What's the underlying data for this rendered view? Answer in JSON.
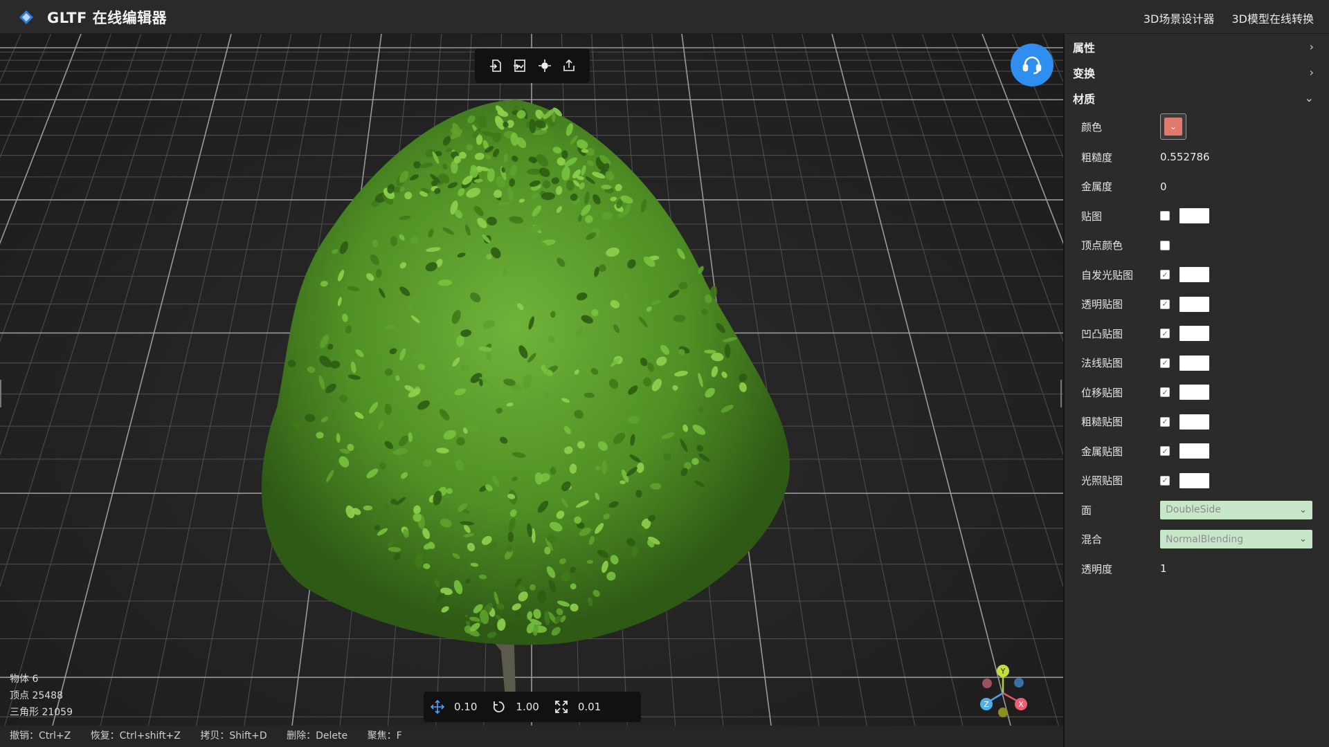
{
  "app": {
    "title": "GLTF 在线编辑器",
    "links": [
      "3D场景设计器",
      "3D模型在线转换"
    ]
  },
  "toolbar_top": {
    "icons": [
      "import-icon",
      "import-image-icon",
      "center-icon",
      "export-icon"
    ]
  },
  "stats": {
    "objects": "物体 6",
    "vertices": "顶点 25488",
    "triangles": "三角形 21059"
  },
  "transform_snap": {
    "translate": "0.10",
    "rotate": "1.00",
    "scale": "0.01"
  },
  "shortcuts": [
    "撤销：Ctrl+Z",
    "恢复：Ctrl+shift+Z",
    "拷贝：Shift+D",
    "删除：Delete",
    "聚焦：F"
  ],
  "gizmo": {
    "x": "X",
    "y": "Y",
    "z": "Z"
  },
  "panel": {
    "sections": {
      "properties": "属性",
      "transform": "变换",
      "material": "材质"
    },
    "material": {
      "color_label": "颜色",
      "color_value": "#e07a6a",
      "roughness_label": "粗糙度",
      "roughness_value": "0.552786",
      "metalness_label": "金属度",
      "metalness_value": "0",
      "maps": [
        {
          "label": "贴图",
          "checked": false,
          "swatch": true
        },
        {
          "label": "顶点颜色",
          "checked": false,
          "swatch": false
        },
        {
          "label": "自发光贴图",
          "checked": true,
          "swatch": true
        },
        {
          "label": "透明贴图",
          "checked": true,
          "swatch": true
        },
        {
          "label": "凹凸贴图",
          "checked": true,
          "swatch": true
        },
        {
          "label": "法线贴图",
          "checked": true,
          "swatch": true
        },
        {
          "label": "位移贴图",
          "checked": true,
          "swatch": true
        },
        {
          "label": "粗糙贴图",
          "checked": true,
          "swatch": true
        },
        {
          "label": "金属贴图",
          "checked": true,
          "swatch": true
        },
        {
          "label": "光照贴图",
          "checked": true,
          "swatch": true
        }
      ],
      "side_label": "面",
      "side_value": "DoubleSide",
      "blending_label": "混合",
      "blending_value": "NormalBlending",
      "opacity_label": "透明度",
      "opacity_value": "1"
    }
  },
  "colors": {
    "accent_blue": "#2f8ff0",
    "select_bg": "#c7e7c9",
    "foliage": "#4f8f24"
  }
}
